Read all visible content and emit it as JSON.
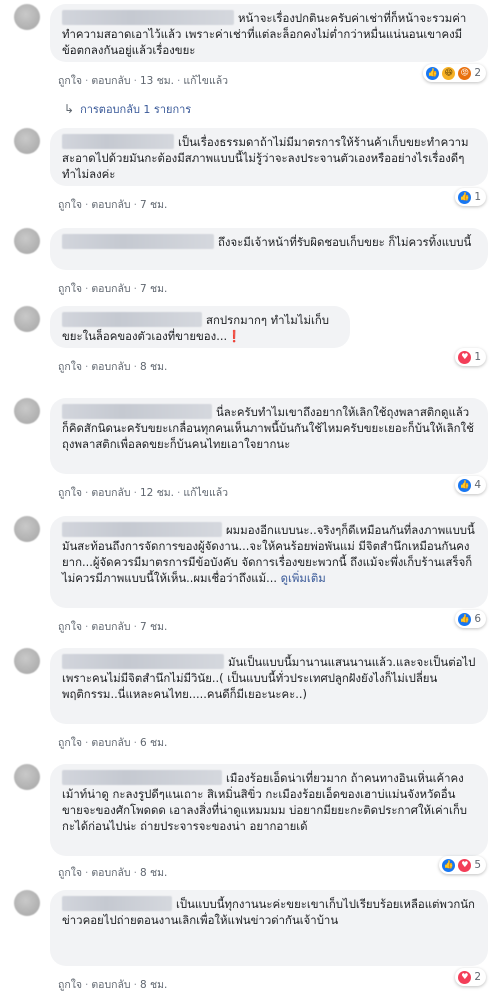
{
  "actions": {
    "like": "ถูกใจ",
    "reply": "ตอบกลับ",
    "edited": "แก้ไขแล้ว",
    "see_more": "ดูเพิ่มเติม",
    "sep": "·"
  },
  "reply_link": "การตอบกลับ 1 รายการ",
  "comments": [
    {
      "text": "หน้าจะเรื่องปกตินะครับค่าเช่าที่ก็หน้าจะรวมค่าทำความสอาดเอาไว้แล้ว เพราะค่าเช่าที่แต่ละล็อกคงไม่ต่ำกว่าหมื่นแน่นอนเขาคงมีข้อตกลงกันอยู่แล้วเรื่องขยะ",
      "time": "13 ชม.",
      "edited": true,
      "reactions": [
        "like",
        "haha",
        "angry"
      ],
      "count": "2"
    },
    {
      "text": "เป็นเรื่องธรรมดาถ้าไม่มีมาตรการให้ร้านค้าเก็บขยะทำความสะอาดไปด้วยมันกะต้องมีสภาพแบบนี้ไม่รู้ว่าจะลงประจานตัวเองหรืออย่างไรเรื่องดีๆทำไม่ลงค่ะ",
      "time": "7 ชม.",
      "edited": false,
      "reactions": [
        "like"
      ],
      "count": "1"
    },
    {
      "text": "ถึงจะมีเจ้าหน้าที่รับผิดชอบเก็บขยะ ก็ไม่ควรทิ้งแบบนี้",
      "time": "7 ชม.",
      "edited": false,
      "reactions": [],
      "count": ""
    },
    {
      "text": "สกปรกมากๆ ทำไมไม่เก็บขยะในล็อคของตัวเองที่ขายของ...",
      "exclaim": "❗",
      "time": "8 ชม.",
      "edited": false,
      "reactions": [
        "love"
      ],
      "count": "1"
    },
    {
      "text": "นี่ละครับทำไมเขาถึงอยากให้เลิกใช้ถุงพลาสติกดูแล้วก็คิดสักนิดนะครับขยะเกลื่อนทุกคนเห็นภาพนี้บ้นกันใช้ไหมครับขยะเยอะก็บ้นให้เลิกใช้ถุงพลาสติกเพื่อลดขยะก็บ้นคนไทยเอาใจยากนะ",
      "time": "12 ชม.",
      "edited": true,
      "reactions": [
        "like"
      ],
      "count": "4"
    },
    {
      "text": "ผมมองอีกแบบนะ..จริงๆก็ดีเหมือนกันที่ลงภาพแบบนี้ มันสะท้อนถึงการจัดการของผู้จัดงาน...จะให้คนร้อยพ่อพันแม่ มีจิตสำนึกเหมือนกันคงยาก...ผู้จัดควรมีมาตรการมีข้อบังคับ จัดการเรื่องขยะพวกนี้ ถึงแม้จะพึ่งเก็บร้านเสร็จก็ไม่ควรมีภาพแบบนี้ให้เห็น..ผมเชื่อว่าถึงแม้...",
      "see_more": true,
      "time": "7 ชม.",
      "edited": false,
      "reactions": [
        "like"
      ],
      "count": "6"
    },
    {
      "text": "มันเป็นแบบนี้มานานแสนนานแล้ว.และจะเป็นต่อไปเพราะคนไม่มีจิตสำนึกไม่มีวินัย..( เป็นแบบนี้ทั่วประเทศปลูกฝังยังไงก็ไม่เปลี่ยนพฤติกรรม..นี่แหละคนไทย.....คนดีก็มีเยอะนะคะ..)",
      "time": "6 ชม.",
      "edited": false,
      "reactions": [],
      "count": ""
    },
    {
      "text": "เมืองร้อยเอ็ดน่าเที่ยวมาก ถ้าคนทางอินเหิ่นเค้าคงเม้าท์น่าดู กะลงรูปดีๆแนเถาะ สิเหมิ่นสิขิ่ว กะเมืองร้อยเอ็ดของเฮาบ่แม่นจังหวัดอื่นขายจะของศักโพดดด เอาลงสิ่งที่น่าดูแหมมมม บ่อยากมียยะกะติดประกาศให้เค่าเก็บกะได้ก่อนไปน่ะ ถ่ายประจารจะของน่า อยากอายเด้",
      "time": "8 ชม.",
      "edited": false,
      "reactions": [
        "like",
        "love"
      ],
      "count": "5"
    },
    {
      "text": "เป็นแบบนี้ทุกงานนะค่ะขยะเขาเก็บไปเรียบร้อยเหลือแต่พวกนักข่าวคอยไปถ่ายตอนงานเลิกเพื่อให้แฟนข่าวด่ากันเจ้าบ้าน",
      "time": "8 ชม.",
      "edited": false,
      "reactions": [
        "love"
      ],
      "count": "2"
    }
  ]
}
